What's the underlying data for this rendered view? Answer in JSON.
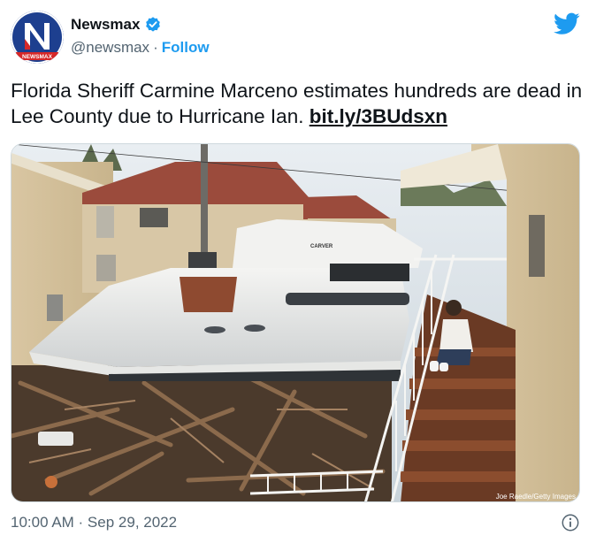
{
  "account": {
    "display_name": "Newsmax",
    "handle": "@newsmax",
    "separator": "·",
    "follow_label": "Follow",
    "avatar_logo_text": "NEWSMAX",
    "verified_icon": "verified-badge-icon",
    "brand_color": "#1d3f8f"
  },
  "tweet": {
    "text": "Florida Sheriff Carmine Marceno estimates hundreds are dead in Lee County due to Hurricane Ian. ",
    "link_text": "bit.ly/3BUdsxn",
    "timestamp": "10:00 AM · Sep 29, 2022"
  },
  "photo": {
    "credit": "Joe Raedle/Getty Images",
    "boat_name": "CARVER"
  },
  "icons": {
    "platform": "twitter-bird-icon",
    "info": "info-icon"
  },
  "colors": {
    "link_blue": "#1d9bf0",
    "twitter_blue": "#1d9bf0",
    "muted_text": "#536471"
  }
}
